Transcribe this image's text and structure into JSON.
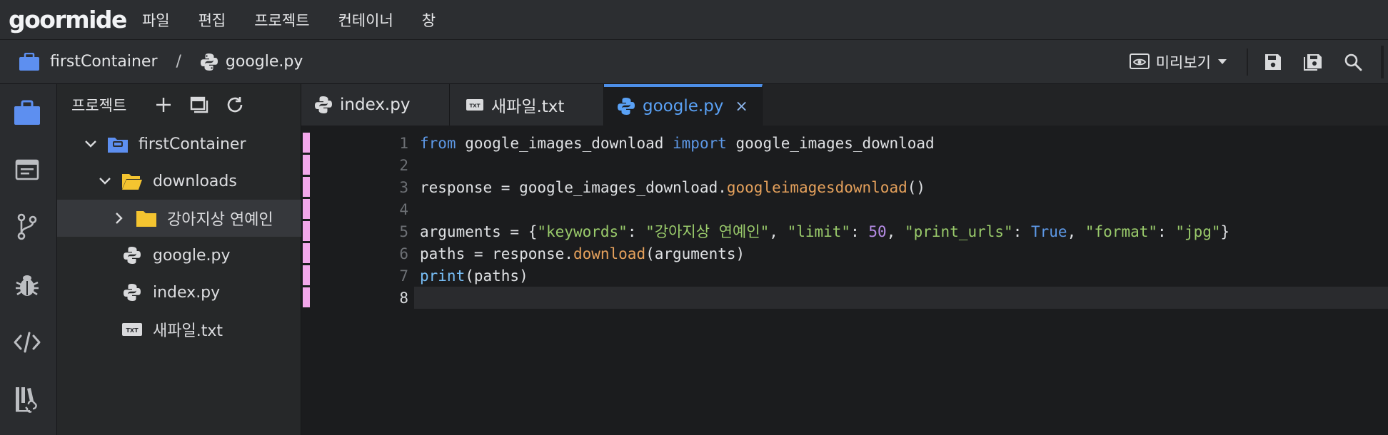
{
  "app": {
    "logo": "goormide",
    "menu": [
      "파일",
      "편집",
      "프로젝트",
      "컨테이너",
      "창"
    ]
  },
  "breadcrumb": {
    "container": "firstContainer",
    "separator": "/",
    "file": "google.py"
  },
  "toolbar": {
    "preview_label": "미리보기"
  },
  "sidebar": {
    "title": "프로젝트",
    "tree": [
      {
        "label": "firstContainer",
        "kind": "container",
        "expanded": true
      },
      {
        "label": "downloads",
        "kind": "folder-open",
        "expanded": true
      },
      {
        "label": "강아지상 연예인",
        "kind": "folder",
        "expanded": false
      },
      {
        "label": "google.py",
        "kind": "python-file"
      },
      {
        "label": "index.py",
        "kind": "python-file"
      },
      {
        "label": "새파일.txt",
        "kind": "txt-file"
      }
    ]
  },
  "tabs": [
    {
      "label": "index.py",
      "icon": "python-icon",
      "active": false
    },
    {
      "label": "새파일.txt",
      "icon": "txt-icon",
      "active": false
    },
    {
      "label": "google.py",
      "icon": "python-icon",
      "active": true,
      "close": "×"
    }
  ],
  "editor": {
    "current_line": 8,
    "lines": [
      {
        "n": "1",
        "text": "from google_images_download import google_images_download"
      },
      {
        "n": "2",
        "text": ""
      },
      {
        "n": "3",
        "text": "response = google_images_download.googleimagesdownload()"
      },
      {
        "n": "4",
        "text": ""
      },
      {
        "n": "5",
        "text": "arguments = {\"keywords\": \"강아지상 연예인\", \"limit\": 50, \"print_urls\": True, \"format\": \"jpg\"}"
      },
      {
        "n": "6",
        "text": "paths = response.download(arguments)"
      },
      {
        "n": "7",
        "text": "print(paths)"
      },
      {
        "n": "8",
        "text": ""
      }
    ],
    "tokens": {
      "l1": [
        "from",
        " google_images_download ",
        "import",
        " google_images_download"
      ],
      "l3": [
        "response = google_images_download.",
        "googleimagesdownload",
        "()"
      ],
      "l5": [
        "arguments = {",
        "\"keywords\"",
        ": ",
        "\"강아지상 연예인\"",
        ", ",
        "\"limit\"",
        ": ",
        "50",
        ", ",
        "\"print_urls\"",
        ": ",
        "True",
        ", ",
        "\"format\"",
        ": ",
        "\"jpg\"",
        "}"
      ],
      "l6": [
        "paths = response.",
        "download",
        "(arguments)"
      ],
      "l7": [
        "print",
        "(paths)"
      ]
    }
  },
  "colors": {
    "accent": "#4d8fe8",
    "modified_marker": "#f2a7ea",
    "keyword": "#5d98e6",
    "function": "#e5a15c",
    "string": "#9acb6b",
    "number": "#b68ce6"
  }
}
